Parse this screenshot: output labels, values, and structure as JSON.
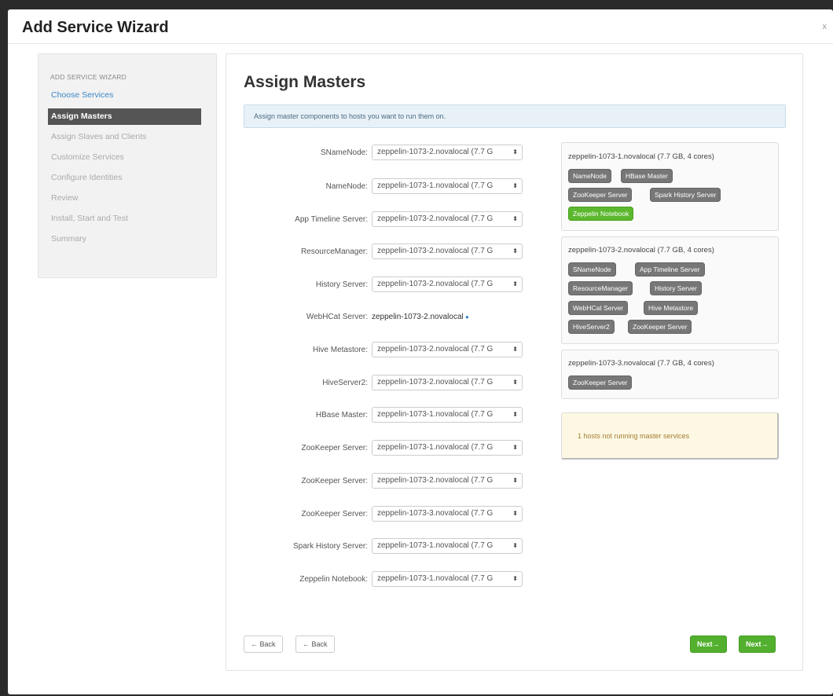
{
  "window": {
    "title": "Add Service Wizard",
    "close_label": "x"
  },
  "sidebar": {
    "heading": "ADD SERVICE WIZARD",
    "items": [
      {
        "label": "Choose Services",
        "state": "link"
      },
      {
        "label": "Assign Masters",
        "state": "active"
      },
      {
        "label": "Assign Slaves and Clients",
        "state": "disabled"
      },
      {
        "label": "Customize Services",
        "state": "disabled"
      },
      {
        "label": "Configure Identities",
        "state": "disabled"
      },
      {
        "label": "Review",
        "state": "disabled"
      },
      {
        "label": "Install, Start and Test",
        "state": "disabled"
      },
      {
        "label": "Summary",
        "state": "disabled"
      }
    ]
  },
  "main": {
    "title": "Assign Masters",
    "info": "Assign master components to hosts you want to run them on.",
    "fields": [
      {
        "label": "SNameNode:",
        "value": "zeppelin-1073-2.novalocal (7.7 G"
      },
      {
        "label": "NameNode:",
        "value": "zeppelin-1073-1.novalocal (7.7 G"
      },
      {
        "label": "App Timeline Server:",
        "value": "zeppelin-1073-2.novalocal (7.7 G"
      },
      {
        "label": "ResourceManager:",
        "value": "zeppelin-1073-2.novalocal (7.7 G"
      },
      {
        "label": "History Server:",
        "value": "zeppelin-1073-2.novalocal (7.7 G"
      },
      {
        "label": "WebHCat Server:",
        "value": "zeppelin-1073-2.novalocal"
      },
      {
        "label": "Hive Metastore:",
        "value": "zeppelin-1073-2.novalocal (7.7 G"
      },
      {
        "label": "HiveServer2:",
        "value": "zeppelin-1073-2.novalocal (7.7 G"
      },
      {
        "label": "HBase Master:",
        "value": "zeppelin-1073-1.novalocal (7.7 G"
      },
      {
        "label": "ZooKeeper Server:",
        "value": "zeppelin-1073-1.novalocal (7.7 G"
      },
      {
        "label": "ZooKeeper Server:",
        "value": "zeppelin-1073-2.novalocal (7.7 G"
      },
      {
        "label": "ZooKeeper Server:",
        "value": "zeppelin-1073-3.novalocal (7.7 G"
      },
      {
        "label": "Spark History Server:",
        "value": "zeppelin-1073-1.novalocal (7.7 G"
      },
      {
        "label": "Zeppelin Notebook:",
        "value": "zeppelin-1073-1.novalocal (7.7 G"
      }
    ],
    "select_arrows": "⬍",
    "hosts": [
      {
        "title": "zeppelin-1073-1.novalocal (7.7 GB, 4 cores)",
        "components": [
          "NameNode",
          "HBase Master",
          "ZooKeeper Server",
          "Spark History Server",
          "Zeppelin Notebook"
        ]
      },
      {
        "title": "zeppelin-1073-2.novalocal (7.7 GB, 4 cores)",
        "components": [
          "SNameNode",
          "App Timeline Server",
          "ResourceManager",
          "History Server",
          "WebHCat Server",
          "Hive Metastore",
          "HiveServer2",
          "ZooKeeper Server"
        ]
      },
      {
        "title": "zeppelin-1073-3.novalocal (7.7 GB, 4 cores)",
        "components": [
          "ZooKeeper Server"
        ]
      }
    ],
    "warning": "1 hosts not running master services",
    "buttons": {
      "back_1": "← Back",
      "back_2": "← Back",
      "next_1": "Next→",
      "next_2": "Next→"
    }
  },
  "colors": {
    "active_nav": "#555555",
    "link": "#3a87c8",
    "badge": "#777777",
    "badge_new": "#5cb82e",
    "next_button": "#53b02f",
    "warning_bg": "#fcf8e3"
  }
}
